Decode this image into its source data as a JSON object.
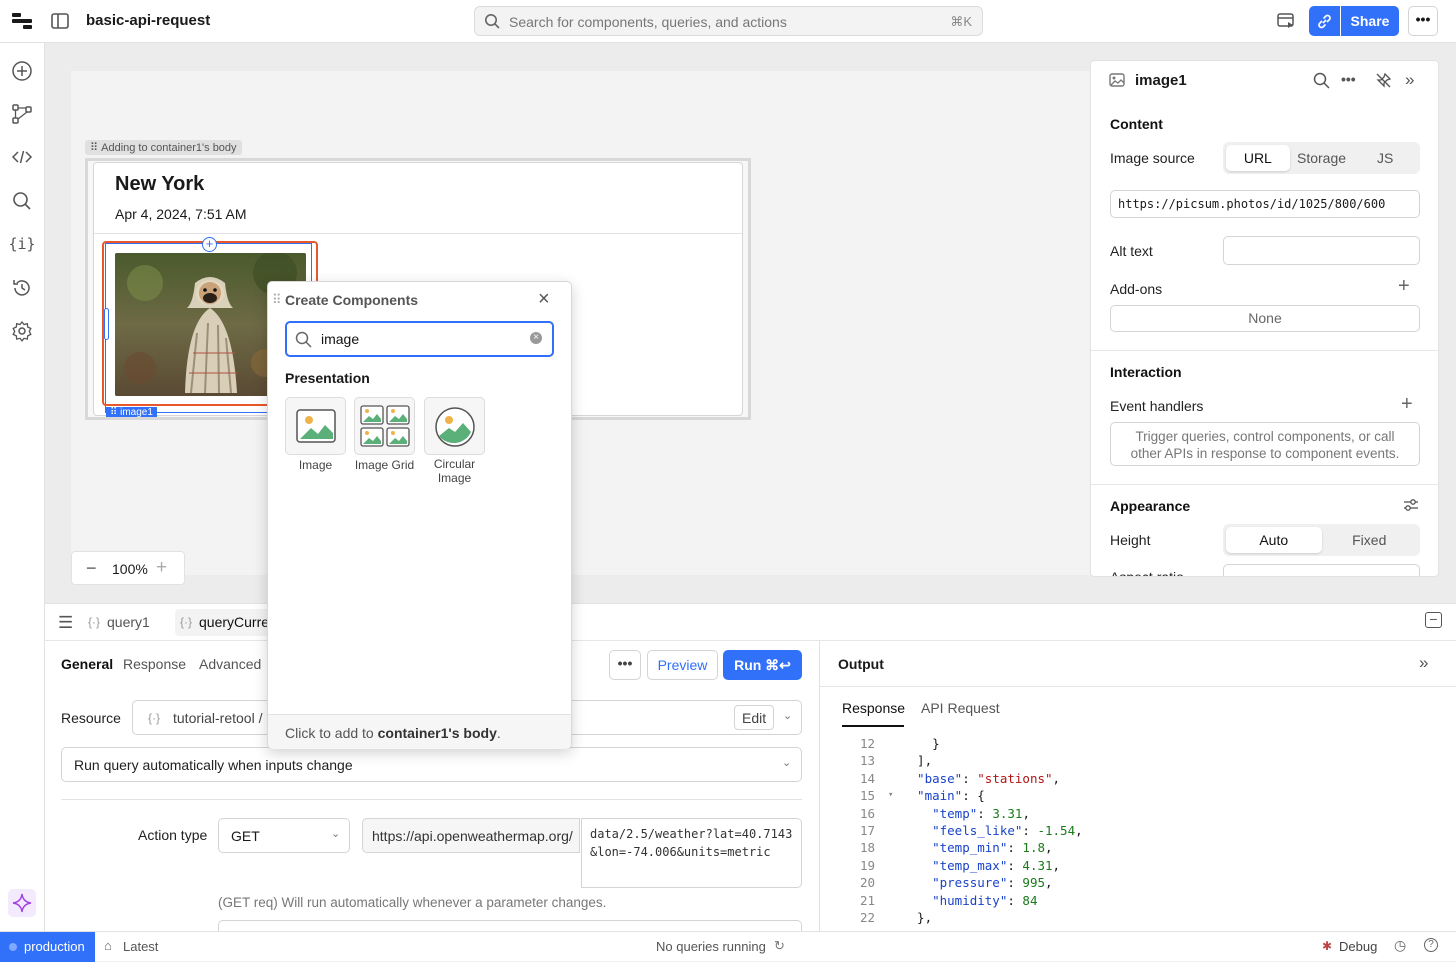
{
  "app": {
    "title": "basic-api-request"
  },
  "search": {
    "placeholder": "Search for components, queries, and actions",
    "shortcut": "⌘K"
  },
  "toolbar": {
    "share_label": "Share"
  },
  "canvas": {
    "drop_hint": "Adding to container1's body",
    "container_title": "New York",
    "container_subtitle": "Apr 4, 2024, 7:51 AM",
    "image_tag": "image1",
    "zoom_level": "100%"
  },
  "popup": {
    "title": "Create Components",
    "search_value": "image",
    "section": "Presentation",
    "items": [
      {
        "label": "Image",
        "icon": "image-icon"
      },
      {
        "label": "Image Grid",
        "icon": "image-grid-icon"
      },
      {
        "label": "Circular Image",
        "icon": "circular-image-icon"
      }
    ],
    "footer_prefix": "Click to add to ",
    "footer_bold": "container1's body",
    "footer_suffix": "."
  },
  "inspector": {
    "component_name": "image1",
    "content_heading": "Content",
    "image_source_label": "Image source",
    "source_tabs": [
      "URL",
      "Storage",
      "JS"
    ],
    "source_selected": "URL",
    "url_value": "https://picsum.photos/id/1025/800/600",
    "alt_text_label": "Alt text",
    "addons_label": "Add-ons",
    "addons_value": "None",
    "interaction_heading": "Interaction",
    "event_handlers_label": "Event handlers",
    "event_handlers_hint": "Trigger queries, control components, or call other APIs in response to component events.",
    "appearance_heading": "Appearance",
    "height_label": "Height",
    "height_options": [
      "Auto",
      "Fixed"
    ],
    "height_selected": "Auto",
    "aspect_ratio_label": "Aspect ratio"
  },
  "query_panel": {
    "tabs": [
      "query1",
      "queryCurre"
    ],
    "subtabs": [
      "General",
      "Response",
      "Advanced"
    ],
    "preview_label": "Preview",
    "run_label": "Run ⌘↩",
    "resource_label": "Resource",
    "resource_value": "tutorial-retool /",
    "edit_label": "Edit",
    "trigger_value": "Run query automatically when inputs change",
    "action_type_label": "Action type",
    "method": "GET",
    "url_base": "https://api.openweathermap.org/",
    "url_path": "data/2.5/weather?lat=40.7143&lon=-74.006&units=metric",
    "hint": "(GET req) Will run automatically whenever a parameter changes."
  },
  "output": {
    "heading": "Output",
    "tabs": [
      "Response",
      "API Request"
    ],
    "lines": [
      {
        "n": "12",
        "text": "    }"
      },
      {
        "n": "13",
        "text": "  ],"
      },
      {
        "n": "14",
        "key": "  \"base\"",
        "val": "\"stations\"",
        "end": ",",
        "kind": "red"
      },
      {
        "n": "15",
        "key": "  \"main\"",
        "val": "{",
        "end": "",
        "kind": "plain"
      },
      {
        "n": "16",
        "key": "    \"temp\"",
        "val": "3.31",
        "end": ",",
        "kind": "num"
      },
      {
        "n": "17",
        "key": "    \"feels_like\"",
        "val": "-1.54",
        "end": ",",
        "kind": "num"
      },
      {
        "n": "18",
        "key": "    \"temp_min\"",
        "val": "1.8",
        "end": ",",
        "kind": "num"
      },
      {
        "n": "19",
        "key": "    \"temp_max\"",
        "val": "4.31",
        "end": ",",
        "kind": "num"
      },
      {
        "n": "20",
        "key": "    \"pressure\"",
        "val": "995",
        "end": ",",
        "kind": "num"
      },
      {
        "n": "21",
        "key": "    \"humidity\"",
        "val": "84",
        "end": "",
        "kind": "num"
      },
      {
        "n": "22",
        "text": "  },"
      }
    ]
  },
  "status": {
    "env": "production",
    "version": "Latest",
    "queries": "No queries running",
    "debug": "Debug"
  },
  "colors": {
    "accent": "#3170f9",
    "env": "#3170f9",
    "selection": "#e8582c"
  }
}
